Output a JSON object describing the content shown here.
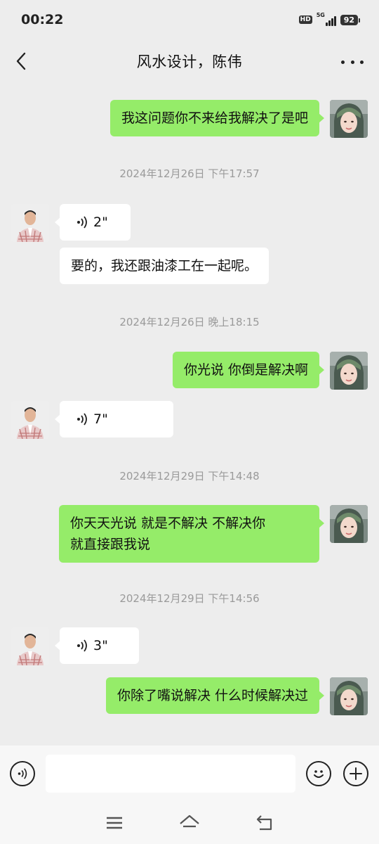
{
  "status_bar": {
    "time": "00:22",
    "hd": "HD",
    "network": "5G",
    "battery": "92"
  },
  "header": {
    "title": "风水设计，陈伟",
    "back_icon": "chevron-left-icon",
    "more_icon": "more-dots-icon"
  },
  "messages": [
    {
      "type": "text",
      "sender": "me",
      "text": "我这问题你不来给我解决了是吧"
    },
    {
      "type": "time",
      "text": "2024年12月26日 下午17:57"
    },
    {
      "type": "voice",
      "sender": "other",
      "duration": "2\""
    },
    {
      "type": "text",
      "sender": "other",
      "text": "要的，我还跟油漆工在一起呢。"
    },
    {
      "type": "time",
      "text": "2024年12月26日 晚上18:15"
    },
    {
      "type": "text",
      "sender": "me",
      "text": "你光说 你倒是解决啊"
    },
    {
      "type": "voice",
      "sender": "other",
      "duration": "7\""
    },
    {
      "type": "time",
      "text": "2024年12月29日 下午14:48"
    },
    {
      "type": "text",
      "sender": "me",
      "lines": [
        "你天天光说  就是不解决  不解决你",
        "就直接跟我说"
      ]
    },
    {
      "type": "time",
      "text": "2024年12月29日 下午14:56"
    },
    {
      "type": "voice",
      "sender": "other",
      "duration": "3\""
    },
    {
      "type": "text",
      "sender": "me",
      "text": "你除了嘴说解决  什么时候解决过"
    }
  ],
  "input_bar": {
    "voice_icon": "voice-input-icon",
    "placeholder": "",
    "emoji_icon": "emoji-icon",
    "plus_icon": "plus-icon"
  },
  "nav_bar": {
    "icons": [
      "menu-icon",
      "home-icon",
      "back-nav-icon"
    ]
  },
  "colors": {
    "background": "#ededed",
    "my_bubble": "#95ec69",
    "other_bubble": "#ffffff",
    "timestamp": "#9a9a9a"
  }
}
